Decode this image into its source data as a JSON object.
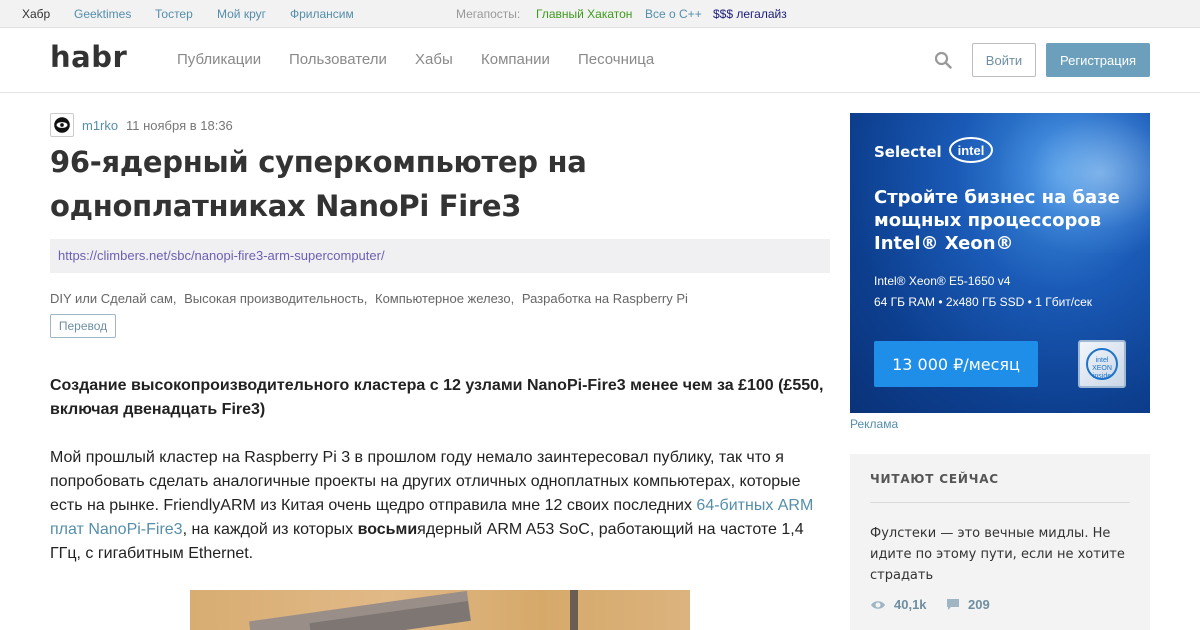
{
  "network_bar": {
    "habr": "Хабр",
    "geektimes": "Geektimes",
    "toster": "Тостер",
    "moi_krug": "Мой круг",
    "freelansim": "Фрилансим",
    "megaposts_label": "Мегапосты:",
    "megaposts": [
      "Главный Хакатон",
      "Все о С++",
      "$$$ легалайз"
    ]
  },
  "header": {
    "logo": "habr",
    "nav": [
      "Публикации",
      "Пользователи",
      "Хабы",
      "Компании",
      "Песочница"
    ],
    "login_label": "Войти",
    "register_label": "Регистрация",
    "accent_color": "#6b9fbb"
  },
  "article": {
    "author": "m1rko",
    "date": "11 ноября в 18:36",
    "title": "96-ядерный суперкомпьютер на одноплатниках NanoPi Fire3",
    "source_url": "https://climbers.net/sbc/nanopi-fire3-arm-supercomputer/",
    "hubs": [
      "DIY или Сделай сам,",
      "Высокая производительность,",
      "Компьютерное железо,",
      "Разработка на Raspberry Pi"
    ],
    "badge": "Перевод",
    "lead": "Создание высокопроизводительного кластера с 12 узлами NanoPi-Fire3 менее чем за £100 (£550, включая двенадцать Fire3)",
    "para_part1": "Мой прошлый кластер на Raspberry Pi 3 в прошлом году немало заинтересовал публику, так что я попробовать сделать аналогичные проекты на других отличных одноплатных компьютерах, которые есть на рынке. FriendlyARM из Китая очень щедро отправила мне 12 своих последних ",
    "para_link": "64-битных ARM плат NanoPi-Fire3",
    "para_part2": ", на каждой из которых ",
    "para_bold": "восьми",
    "para_part3": "ядерный ARM A53 SoC, работающий на частоте 1,4 ГГц, с гигабитным Ethernet."
  },
  "ad": {
    "brand": "Selectel",
    "partner": "intel",
    "headline": "Стройте бизнес на базе мощных процессоров Intel® Xeon®",
    "spec1": "Intel® Xeon® E5-1650 v4",
    "spec2": "64 ГБ RAM • 2x480 ГБ SSD • 1 Гбит/сек",
    "price": "13 000 ₽/месяц",
    "chip_text": "intel XEON inside",
    "label": "Реклама"
  },
  "reading_now": {
    "title": "ЧИТАЮТ СЕЙЧАС",
    "post_title": "Фулстеки — это вечные мидлы. Не идите по этому пути, если не хотите страдать",
    "views": "40,1k",
    "comments": "209"
  }
}
